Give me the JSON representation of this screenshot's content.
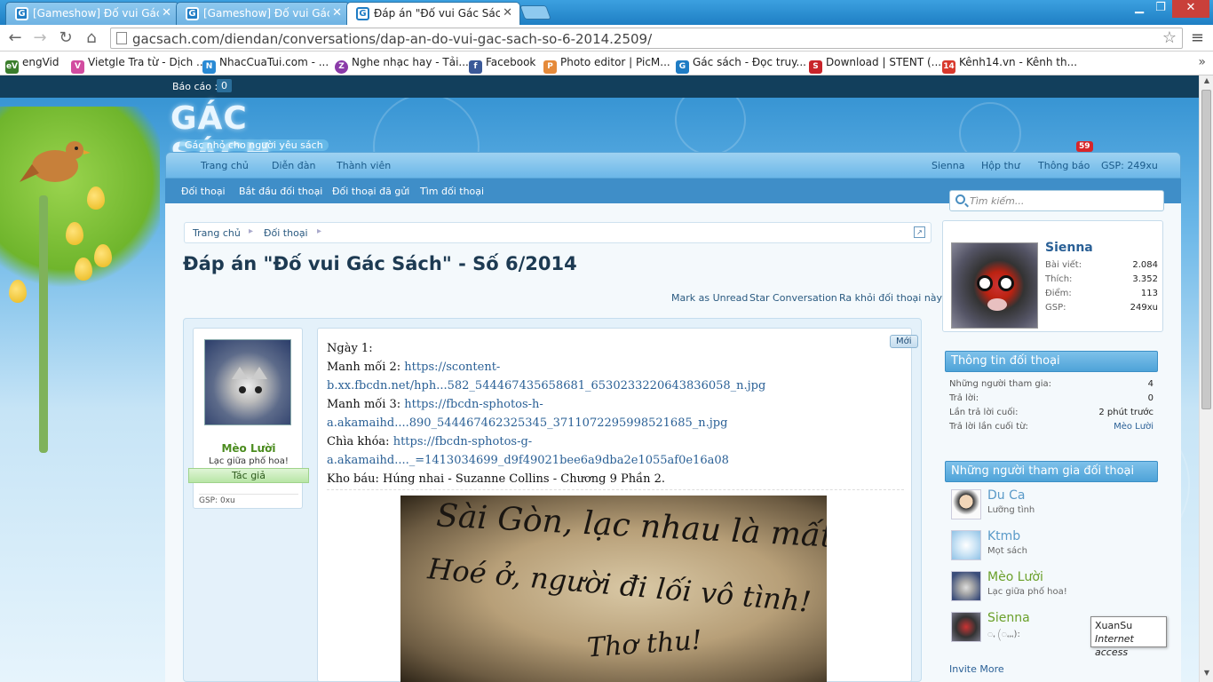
{
  "browser": {
    "tabs": [
      {
        "label": "[Gameshow] Đố vui Gác S",
        "active": false
      },
      {
        "label": "[Gameshow] Đố vui Gác S",
        "active": false
      },
      {
        "label": "Đáp án \"Đố vui Gác Sách\"",
        "active": true
      }
    ],
    "address": "gacsach.com/diendan/conversations/dap-an-do-vui-gac-sach-so-6-2014.2509/",
    "bookmarks": [
      {
        "label": "engVid",
        "icon": "eV"
      },
      {
        "label": "Vietgle Tra từ - Dịch ...",
        "icon": "V"
      },
      {
        "label": "NhacCuaTui.com - ...",
        "icon": "N"
      },
      {
        "label": "Nghe nhạc hay - Tải...",
        "icon": "Z"
      },
      {
        "label": "Facebook",
        "icon": "f"
      },
      {
        "label": "Photo editor | PicM...",
        "icon": "P"
      },
      {
        "label": "Gác sách - Đọc truy...",
        "icon": "G"
      },
      {
        "label": "Download | STENT (...",
        "icon": "S"
      },
      {
        "label": "Kênh14.vn - Kênh th...",
        "icon": "14"
      }
    ]
  },
  "site": {
    "report_label": "Báo cáo :",
    "report_count": "0",
    "logo_text": "GÁC SÁCH",
    "logo_tagline": "Gác nhỏ cho người yêu sách",
    "nav": {
      "home": "Trang chủ",
      "forums": "Diễn đàn",
      "members": "Thành viên",
      "user": "Sienna",
      "inbox": "Hộp thư",
      "alerts": "Thông báo",
      "alerts_count": "59",
      "gsp": "GSP: 249xu"
    },
    "subnav": {
      "conversations": "Đối thoại",
      "start": "Bắt đầu đối thoại",
      "sent": "Đối thoại đã gửi",
      "find": "Tìm đối thoại"
    },
    "search_placeholder": "Tìm kiếm..."
  },
  "breadcrumb": {
    "home": "Trang chủ",
    "conversations": "Đối thoại"
  },
  "thread": {
    "title": "Đáp án \"Đố vui Gác Sách\" - Số 6/2014",
    "actions": {
      "mark_unread": "Mark as Unread",
      "star": "Star Conversation",
      "leave": "Ra khỏi đối thoại này"
    }
  },
  "post": {
    "author": "Mèo Lười",
    "author_status": "Lạc giữa phố hoa!",
    "author_role": "Tác giả",
    "author_gsp": "GSP: 0xu",
    "new_tag": "Mới",
    "lines": {
      "day": "Ngày 1:",
      "clue2_label": "Manh mối 2: ",
      "clue2_link_a": "https://scontent-",
      "clue2_link_b": "b.xx.fbcdn.net/hph...582_544467435658681_6530233220643836058_n.jpg",
      "clue3_label": "Manh mối 3: ",
      "clue3_link_a": "https://fbcdn-sphotos-h-",
      "clue3_link_b": "a.akamaihd....890_544467462325345_3711072295998521685_n.jpg",
      "key_label": "Chìa khóa: ",
      "key_link_a": "https://fbcdn-sphotos-g-",
      "key_link_b": "a.akamaihd...._=1413034699_d9f49021bee6a9dba2e1055af0e16a08",
      "treasure": "Kho báu: Húng nhai - Suzanne Collins - Chương 9 Phần 2."
    },
    "photo_text": {
      "line1": "Sài Gòn, lạc nhau là mất",
      "line2": "Hoé ở, người đi lối vô tình!",
      "line3": "Thơ thu!"
    }
  },
  "sidebar": {
    "user": {
      "name": "Sienna",
      "posts_label": "Bài viết:",
      "posts": "2.084",
      "likes_label": "Thích:",
      "likes": "3.352",
      "points_label": "Điểm:",
      "points": "113",
      "gsp_label": "GSP:",
      "gsp": "249xu"
    },
    "convo_info": {
      "heading": "Thông tin đối thoại",
      "participants_label": "Những người tham gia:",
      "participants": "4",
      "replies_label": "Trả lời:",
      "replies": "0",
      "last_reply_label": "Lần trả lời cuối:",
      "last_reply": "2 phút trước",
      "last_replier_label": "Trả lời lần cuối từ:",
      "last_replier": "Mèo Lười"
    },
    "participants_heading": "Những người tham gia đối thoại",
    "participants": [
      {
        "name": "Du Ca",
        "status": "Lưỡng tình"
      },
      {
        "name": "Ktmb",
        "status": "Mọt sách"
      },
      {
        "name": "Mèo Lười",
        "status": "Lạc giữa phố hoa!"
      },
      {
        "name": "Sienna",
        "status": "ꩻ (ꩻꩻꩻ):"
      }
    ],
    "invite": "Invite More"
  },
  "tooltip": {
    "name": "XuanSu",
    "status": "Internet access"
  }
}
